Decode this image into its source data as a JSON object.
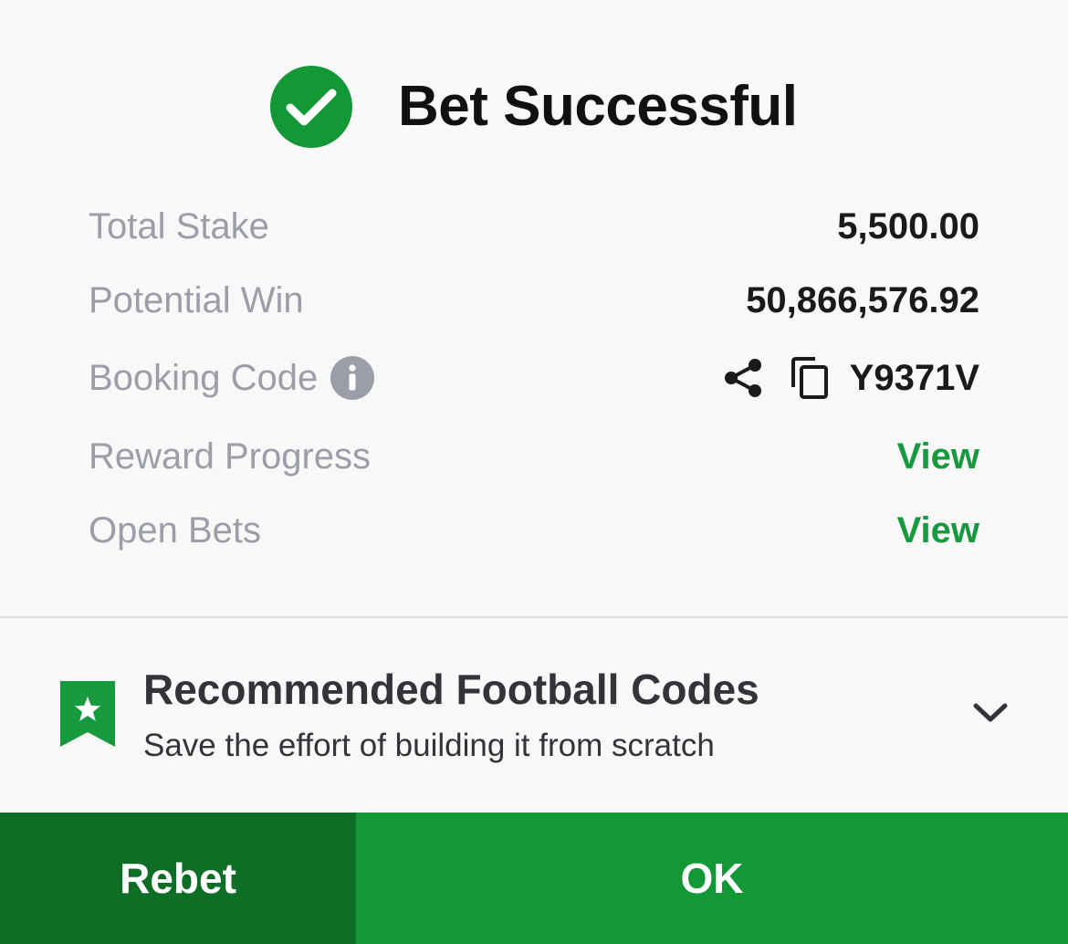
{
  "header": {
    "title": "Bet Successful"
  },
  "details": {
    "total_stake": {
      "label": "Total Stake",
      "value": "5,500.00"
    },
    "potential_win": {
      "label": "Potential Win",
      "value": "50,866,576.92"
    },
    "booking_code": {
      "label": "Booking Code",
      "value": "Y9371V"
    },
    "reward_progress": {
      "label": "Reward Progress",
      "action": "View"
    },
    "open_bets": {
      "label": "Open Bets",
      "action": "View"
    }
  },
  "recommended": {
    "title": "Recommended Football Codes",
    "subtitle": "Save the effort of building it from scratch"
  },
  "buttons": {
    "rebet": "Rebet",
    "ok": "OK"
  },
  "icons": {
    "success": "check-circle-icon",
    "info": "info-icon",
    "share": "share-icon",
    "copy": "copy-icon",
    "bookmark": "bookmark-star-icon",
    "chevron": "chevron-down-icon"
  },
  "colors": {
    "accent_green": "#129835",
    "dark_green": "#0e6e26",
    "link_green": "#169a3d",
    "label_gray": "#9b9ea8"
  }
}
